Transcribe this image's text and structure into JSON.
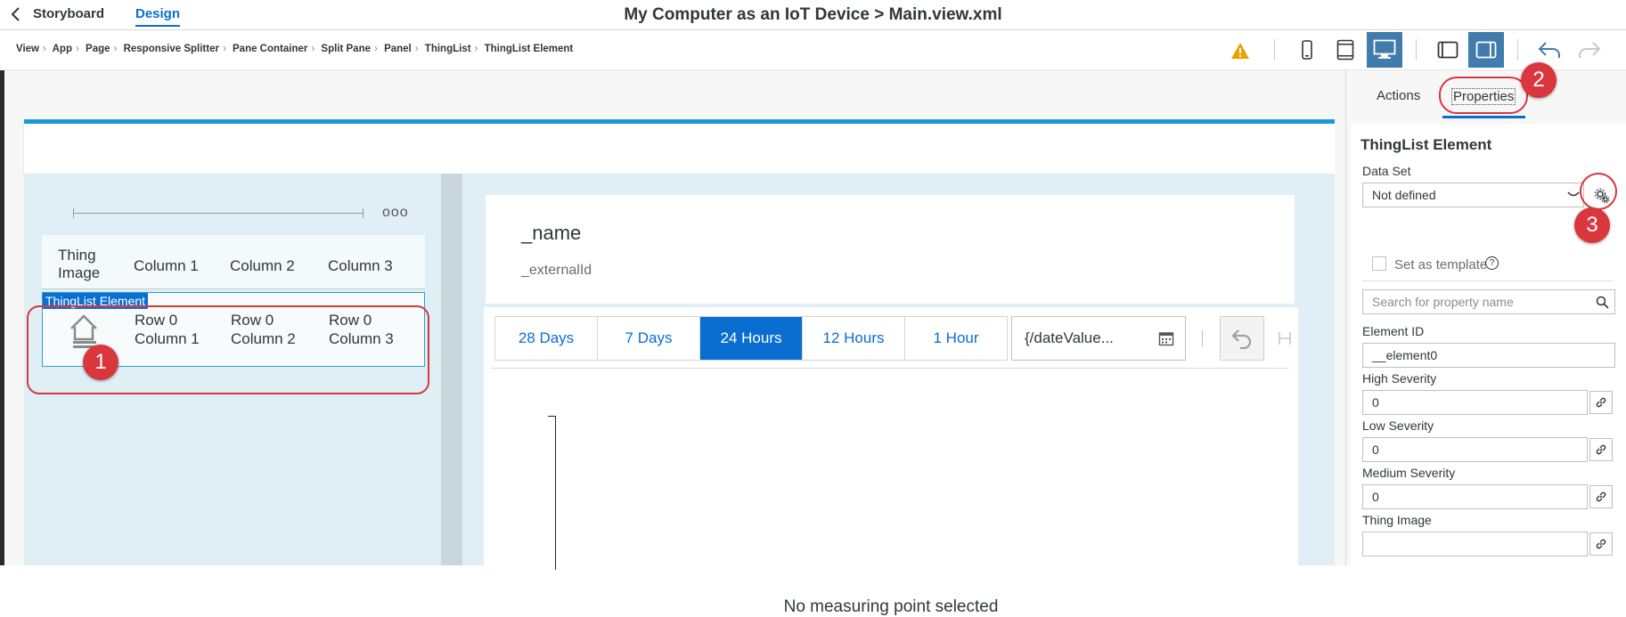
{
  "topbar": {
    "back_label": "Storyboard",
    "design_label": "Design",
    "title": "My Computer as an IoT Device > Main.view.xml"
  },
  "breadcrumb": [
    "View",
    "App",
    "Page",
    "Responsive Splitter",
    "Pane Container",
    "Split Pane",
    "Panel",
    "ThingList",
    "ThingList Element"
  ],
  "toolbar": {
    "icons": [
      "warning-icon",
      "phone-icon",
      "tablet-icon",
      "desktop-icon",
      "left-panel-icon",
      "right-panel-icon",
      "undo-icon",
      "redo-icon"
    ],
    "selected_device": "desktop",
    "warning_color": "#e9a100",
    "accent": "#0a6ed1"
  },
  "thinglist": {
    "headers": [
      "Thing Image",
      "Column 1",
      "Column 2",
      "Column 3"
    ],
    "element_label": "ThingList Element",
    "row": {
      "col1": "Row 0 Column 1",
      "col2": "Row 0 Column 2",
      "col3": "Row 0 Column 3"
    }
  },
  "object_header": {
    "name": "_name",
    "external_id": "_externalId"
  },
  "time_range": {
    "options": [
      "28 Days",
      "7 Days",
      "24 Hours",
      "12 Hours",
      "1 Hour"
    ],
    "selected": "24 Hours",
    "date_value": "{/dateValue..."
  },
  "chart_message": "No measuring point selected",
  "panel": {
    "tabs": {
      "actions": "Actions",
      "properties": "Properties"
    },
    "heading": "ThingList Element",
    "data_set": {
      "label": "Data Set",
      "value": "Not defined"
    },
    "set_as_template": "Set as template",
    "search_placeholder": "Search for property name",
    "fields": [
      {
        "label": "Element ID",
        "value": "__element0"
      },
      {
        "label": "High Severity",
        "value": "0"
      },
      {
        "label": "Low Severity",
        "value": "0"
      },
      {
        "label": "Medium Severity",
        "value": "0"
      },
      {
        "label": "Thing Image",
        "value": ""
      }
    ]
  },
  "callouts": [
    "1",
    "2",
    "3"
  ],
  "callout_color": "#d9363e"
}
